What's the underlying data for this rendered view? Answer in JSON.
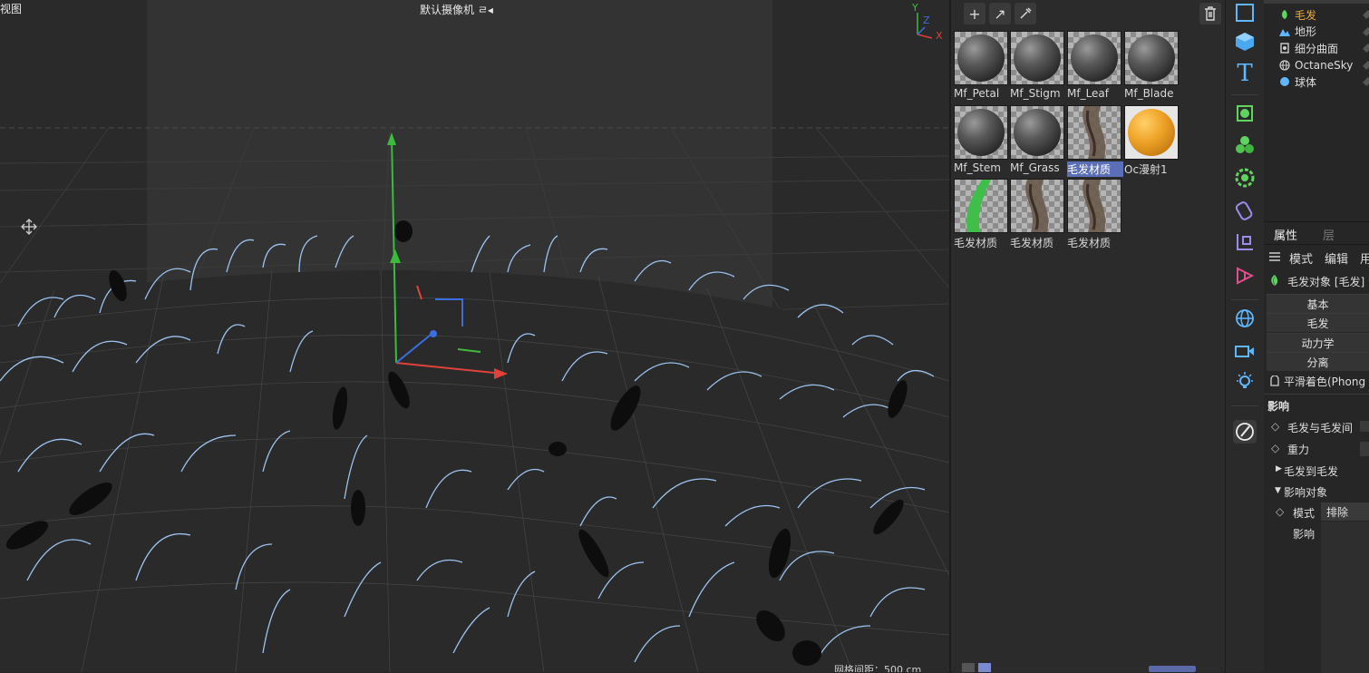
{
  "viewport": {
    "title": "视图",
    "camera": "默认摄像机 ㄹ◂",
    "grid_spacing": "网格间距：500 cm",
    "gizmo": {
      "y": "Y",
      "z": "Z",
      "x": "X"
    }
  },
  "materials": {
    "items": [
      {
        "name": "Mf_Petal",
        "kind": "ball"
      },
      {
        "name": "Mf_Stigm",
        "kind": "ball"
      },
      {
        "name": "Mf_Leaf",
        "kind": "ball"
      },
      {
        "name": "Mf_Blade",
        "kind": "ball"
      },
      {
        "name": "Mf_Stem",
        "kind": "ball"
      },
      {
        "name": "Mf_Grass",
        "kind": "ball"
      },
      {
        "name": "毛发材质",
        "kind": "hair",
        "selected": true
      },
      {
        "name": "Oc漫射1",
        "kind": "orange"
      },
      {
        "name": "毛发材质",
        "kind": "green"
      },
      {
        "name": "毛发材质",
        "kind": "hair"
      },
      {
        "name": "毛发材质",
        "kind": "hair"
      }
    ]
  },
  "objects": {
    "items": [
      {
        "label": "毛发",
        "icon": "hair-icon",
        "active": true
      },
      {
        "label": "地形",
        "icon": "landscape-icon"
      },
      {
        "label": "细分曲面",
        "icon": "subdivision-icon"
      },
      {
        "label": "OctaneSky",
        "icon": "globe-icon"
      },
      {
        "label": "球体",
        "icon": "sphere-icon"
      }
    ]
  },
  "attributes": {
    "tabs": [
      "属性",
      "层"
    ],
    "menu": [
      "模式",
      "编辑",
      "用"
    ],
    "object_name": "毛发对象 [毛发]",
    "section_buttons": [
      "基本",
      "毛发",
      "动力学",
      "分离"
    ],
    "shading": "平滑着色(Phong",
    "influence_title": "影响",
    "hair_to_hair": "毛发与毛发间",
    "gravity": "重力",
    "hair_to_hair_group": "毛发到毛发",
    "influence_objects": "影响对象",
    "mode_label": "模式",
    "mode_value": "排除",
    "influence_label": "影响"
  },
  "colors": {
    "accent_active": "#f0a93a",
    "selection": "#5b6fb8",
    "hair_strands": "#9cc3f0"
  }
}
